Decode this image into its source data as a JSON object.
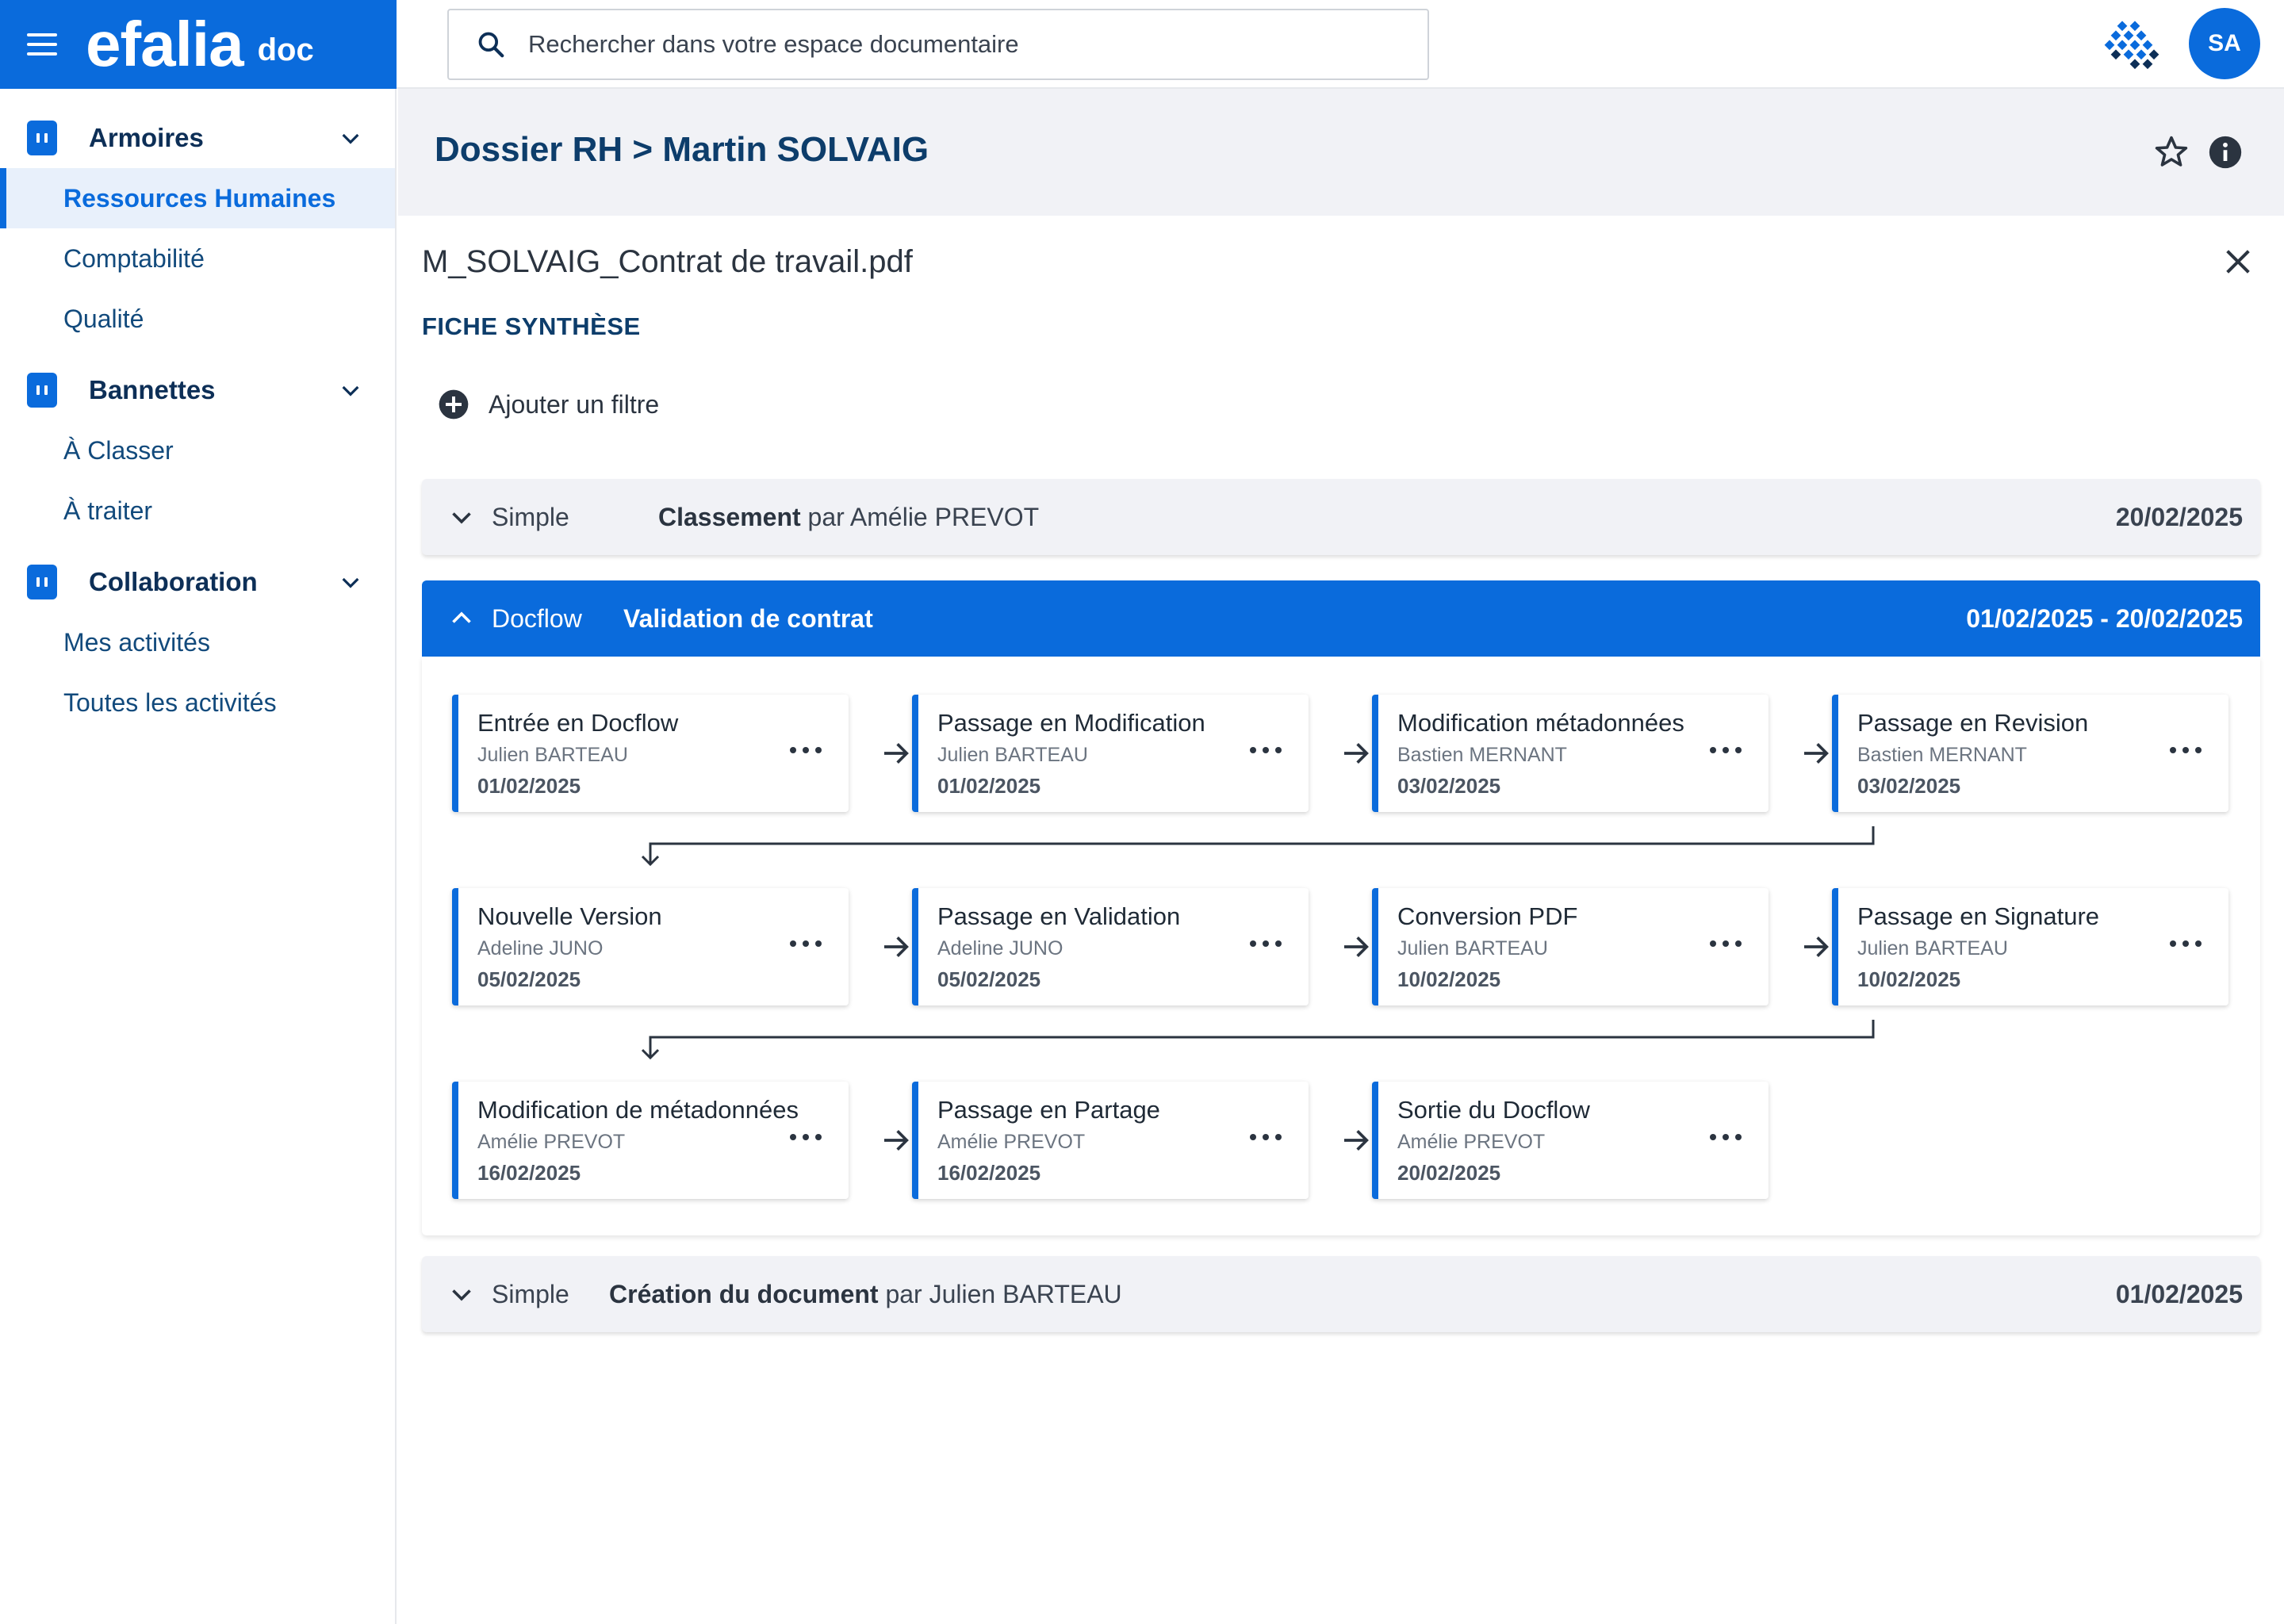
{
  "app": {
    "logo": "efalia",
    "logo_suffix": "doc",
    "avatar_initials": "SA",
    "accent_color": "#0a6bdc"
  },
  "search": {
    "placeholder": "Rechercher dans votre espace documentaire"
  },
  "sidebar": {
    "sections": [
      {
        "title": "Armoires",
        "items": [
          "Ressources Humaines",
          "Comptabilité",
          "Qualité"
        ],
        "active": "Ressources Humaines"
      },
      {
        "title": "Bannettes",
        "items": [
          "À Classer",
          "À traiter"
        ]
      },
      {
        "title": "Collaboration",
        "items": [
          "Mes activités",
          "Toutes les activités"
        ]
      }
    ]
  },
  "header": {
    "breadcrumb": "Dossier RH > Martin SOLVAIG"
  },
  "document": {
    "title": "M_SOLVAIG_Contrat de travail.pdf",
    "section_title": "FICHE SYNTHÈSE",
    "add_filter_label": "Ajouter un filtre"
  },
  "timeline": [
    {
      "type": "Simple",
      "action": "Classement",
      "by": "par Amélie PREVOT",
      "date": "20/02/2025",
      "expanded": false
    },
    {
      "type": "Docflow",
      "action": "Validation de contrat",
      "date": "01/02/2025 - 20/02/2025",
      "expanded": true,
      "steps": [
        {
          "title": "Entrée en Docflow",
          "user": "Julien BARTEAU",
          "date": "01/02/2025"
        },
        {
          "title": "Passage en Modification",
          "user": "Julien BARTEAU",
          "date": "01/02/2025"
        },
        {
          "title": "Modification métadonnées",
          "user": "Bastien MERNANT",
          "date": "03/02/2025"
        },
        {
          "title": "Passage en Revision",
          "user": "Bastien MERNANT",
          "date": "03/02/2025"
        },
        {
          "title": "Nouvelle Version",
          "user": "Adeline JUNO",
          "date": "05/02/2025"
        },
        {
          "title": "Passage en Validation",
          "user": "Adeline JUNO",
          "date": "05/02/2025"
        },
        {
          "title": "Conversion PDF",
          "user": "Julien BARTEAU",
          "date": "10/02/2025"
        },
        {
          "title": "Passage en Signature",
          "user": "Julien BARTEAU",
          "date": "10/02/2025"
        },
        {
          "title": "Modification de métadonnées",
          "user": "Amélie PREVOT",
          "date": "16/02/2025"
        },
        {
          "title": "Passage en Partage",
          "user": "Amélie PREVOT",
          "date": "16/02/2025"
        },
        {
          "title": "Sortie du Docflow",
          "user": "Amélie PREVOT",
          "date": "20/02/2025"
        }
      ]
    },
    {
      "type": "Simple",
      "action": "Création du document",
      "by": "par Julien BARTEAU",
      "date": "01/02/2025",
      "expanded": false
    }
  ]
}
